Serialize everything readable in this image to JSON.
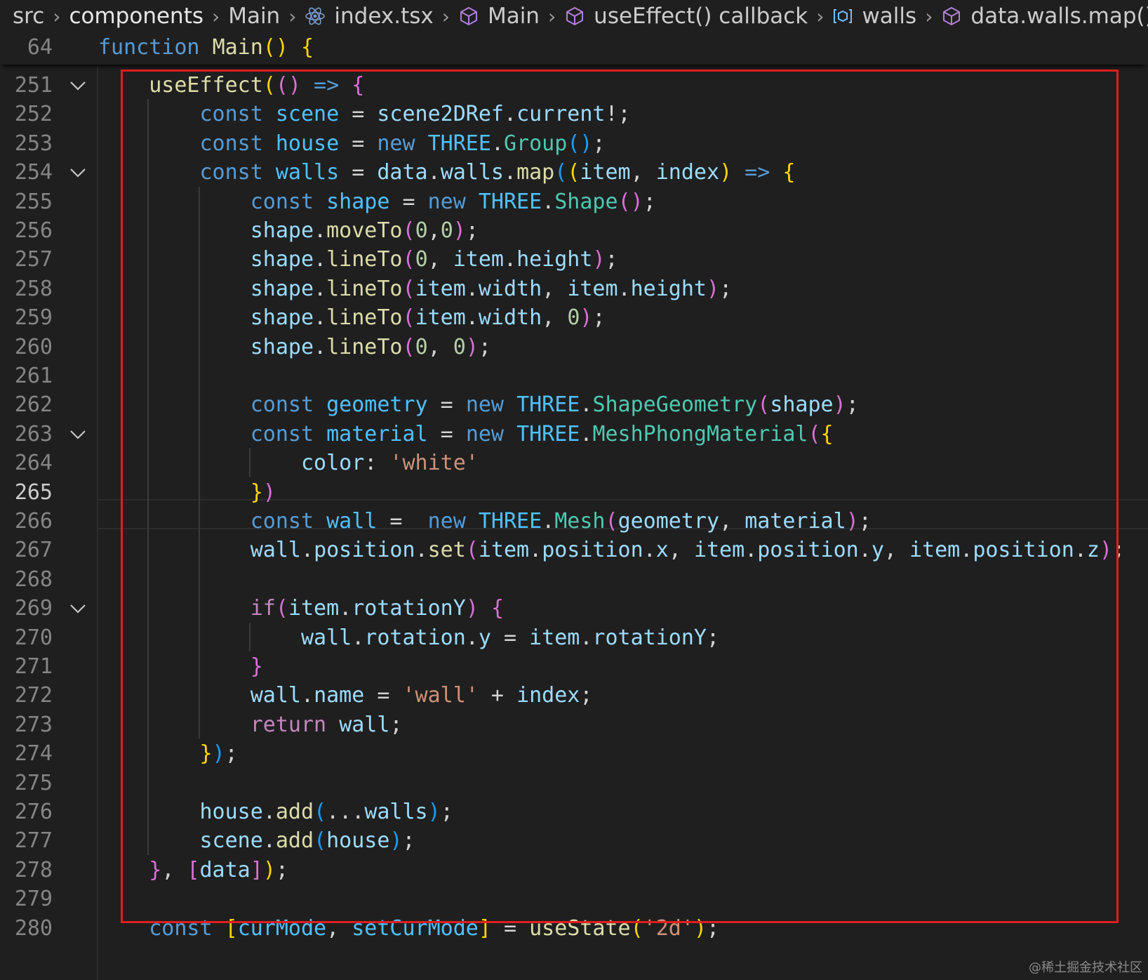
{
  "breadcrumb": [
    {
      "label": "src",
      "icon": ""
    },
    {
      "label": "components",
      "icon": ""
    },
    {
      "label": "Main",
      "icon": ""
    },
    {
      "label": "index.tsx",
      "icon": "react-icon"
    },
    {
      "label": "Main",
      "icon": "cube-icon"
    },
    {
      "label": "useEffect() callback",
      "icon": "cube-icon"
    },
    {
      "label": "walls",
      "icon": "variable-icon"
    },
    {
      "label": "data.walls.map() c",
      "icon": "cube-icon"
    }
  ],
  "sticky": {
    "line": "64",
    "tokens": [
      [
        "function ",
        "kw"
      ],
      [
        "Main",
        "fn"
      ],
      [
        "()",
        "p1"
      ],
      [
        " ",
        "pl"
      ],
      [
        "{",
        "p1"
      ]
    ]
  },
  "current_line": "265",
  "watermark": "@稀土掘金技术社区",
  "colors": {
    "highlight_border": "#e01e1e",
    "background": "#1f1f1f"
  },
  "lines": [
    {
      "n": "251",
      "fold": true,
      "indent": "    ",
      "tokens": [
        [
          "useEffect",
          "fn"
        ],
        [
          "(",
          "p1"
        ],
        [
          "()",
          "p2"
        ],
        [
          " => ",
          "kw"
        ],
        [
          "{",
          "p2"
        ]
      ]
    },
    {
      "n": "252",
      "indent": "        ",
      "tokens": [
        [
          "const ",
          "kw"
        ],
        [
          "scene",
          "cst"
        ],
        [
          " = ",
          "pl"
        ],
        [
          "scene2DRef",
          "var"
        ],
        [
          ".",
          "pl"
        ],
        [
          "current",
          "var"
        ],
        [
          "!;",
          "pl"
        ]
      ]
    },
    {
      "n": "253",
      "indent": "        ",
      "tokens": [
        [
          "const ",
          "kw"
        ],
        [
          "house",
          "cst"
        ],
        [
          " = ",
          "pl"
        ],
        [
          "new ",
          "kw"
        ],
        [
          "THREE",
          "cst"
        ],
        [
          ".",
          "pl"
        ],
        [
          "Group",
          "cls"
        ],
        [
          "()",
          "p3"
        ],
        [
          ";",
          "pl"
        ]
      ]
    },
    {
      "n": "254",
      "fold": true,
      "indent": "        ",
      "tokens": [
        [
          "const ",
          "kw"
        ],
        [
          "walls",
          "cst"
        ],
        [
          " = ",
          "pl"
        ],
        [
          "data",
          "var"
        ],
        [
          ".",
          "pl"
        ],
        [
          "walls",
          "var"
        ],
        [
          ".",
          "pl"
        ],
        [
          "map",
          "fn"
        ],
        [
          "(",
          "p3"
        ],
        [
          "(",
          "p1"
        ],
        [
          "item",
          "var"
        ],
        [
          ", ",
          "pl"
        ],
        [
          "index",
          "var"
        ],
        [
          ")",
          "p1"
        ],
        [
          " => ",
          "kw"
        ],
        [
          "{",
          "p1"
        ]
      ]
    },
    {
      "n": "255",
      "indent": "            ",
      "tokens": [
        [
          "const ",
          "kw"
        ],
        [
          "shape",
          "cst"
        ],
        [
          " = ",
          "pl"
        ],
        [
          "new ",
          "kw"
        ],
        [
          "THREE",
          "cst"
        ],
        [
          ".",
          "pl"
        ],
        [
          "Shape",
          "cls"
        ],
        [
          "()",
          "p2"
        ],
        [
          ";",
          "pl"
        ]
      ]
    },
    {
      "n": "256",
      "indent": "            ",
      "tokens": [
        [
          "shape",
          "var"
        ],
        [
          ".",
          "pl"
        ],
        [
          "moveTo",
          "fn"
        ],
        [
          "(",
          "p2"
        ],
        [
          "0",
          "num"
        ],
        [
          ",",
          "pl"
        ],
        [
          "0",
          "num"
        ],
        [
          ")",
          "p2"
        ],
        [
          ";",
          "pl"
        ]
      ]
    },
    {
      "n": "257",
      "indent": "            ",
      "tokens": [
        [
          "shape",
          "var"
        ],
        [
          ".",
          "pl"
        ],
        [
          "lineTo",
          "fn"
        ],
        [
          "(",
          "p2"
        ],
        [
          "0",
          "num"
        ],
        [
          ", ",
          "pl"
        ],
        [
          "item",
          "var"
        ],
        [
          ".",
          "pl"
        ],
        [
          "height",
          "var"
        ],
        [
          ")",
          "p2"
        ],
        [
          ";",
          "pl"
        ]
      ]
    },
    {
      "n": "258",
      "indent": "            ",
      "tokens": [
        [
          "shape",
          "var"
        ],
        [
          ".",
          "pl"
        ],
        [
          "lineTo",
          "fn"
        ],
        [
          "(",
          "p2"
        ],
        [
          "item",
          "var"
        ],
        [
          ".",
          "pl"
        ],
        [
          "width",
          "var"
        ],
        [
          ", ",
          "pl"
        ],
        [
          "item",
          "var"
        ],
        [
          ".",
          "pl"
        ],
        [
          "height",
          "var"
        ],
        [
          ")",
          "p2"
        ],
        [
          ";",
          "pl"
        ]
      ]
    },
    {
      "n": "259",
      "indent": "            ",
      "tokens": [
        [
          "shape",
          "var"
        ],
        [
          ".",
          "pl"
        ],
        [
          "lineTo",
          "fn"
        ],
        [
          "(",
          "p2"
        ],
        [
          "item",
          "var"
        ],
        [
          ".",
          "pl"
        ],
        [
          "width",
          "var"
        ],
        [
          ", ",
          "pl"
        ],
        [
          "0",
          "num"
        ],
        [
          ")",
          "p2"
        ],
        [
          ";",
          "pl"
        ]
      ]
    },
    {
      "n": "260",
      "indent": "            ",
      "tokens": [
        [
          "shape",
          "var"
        ],
        [
          ".",
          "pl"
        ],
        [
          "lineTo",
          "fn"
        ],
        [
          "(",
          "p2"
        ],
        [
          "0",
          "num"
        ],
        [
          ", ",
          "pl"
        ],
        [
          "0",
          "num"
        ],
        [
          ")",
          "p2"
        ],
        [
          ";",
          "pl"
        ]
      ]
    },
    {
      "n": "261",
      "indent": "",
      "tokens": []
    },
    {
      "n": "262",
      "indent": "            ",
      "tokens": [
        [
          "const ",
          "kw"
        ],
        [
          "geometry",
          "cst"
        ],
        [
          " = ",
          "pl"
        ],
        [
          "new ",
          "kw"
        ],
        [
          "THREE",
          "cst"
        ],
        [
          ".",
          "pl"
        ],
        [
          "ShapeGeometry",
          "cls"
        ],
        [
          "(",
          "p2"
        ],
        [
          "shape",
          "var"
        ],
        [
          ")",
          "p2"
        ],
        [
          ";",
          "pl"
        ]
      ]
    },
    {
      "n": "263",
      "fold": true,
      "indent": "            ",
      "tokens": [
        [
          "const ",
          "kw"
        ],
        [
          "material",
          "cst"
        ],
        [
          " = ",
          "pl"
        ],
        [
          "new ",
          "kw"
        ],
        [
          "THREE",
          "cst"
        ],
        [
          ".",
          "pl"
        ],
        [
          "MeshPhongMaterial",
          "cls"
        ],
        [
          "(",
          "p2"
        ],
        [
          "{",
          "p1"
        ]
      ]
    },
    {
      "n": "264",
      "indent": "                ",
      "tokens": [
        [
          "color",
          "var"
        ],
        [
          ": ",
          "pl"
        ],
        [
          "'white'",
          "str"
        ]
      ]
    },
    {
      "n": "265",
      "indent": "            ",
      "tokens": [
        [
          "}",
          "p1"
        ],
        [
          ")",
          "p2"
        ]
      ]
    },
    {
      "n": "266",
      "indent": "            ",
      "tokens": [
        [
          "const ",
          "kw"
        ],
        [
          "wall",
          "cst"
        ],
        [
          " =  ",
          "pl"
        ],
        [
          "new ",
          "kw"
        ],
        [
          "THREE",
          "cst"
        ],
        [
          ".",
          "pl"
        ],
        [
          "Mesh",
          "cls"
        ],
        [
          "(",
          "p2"
        ],
        [
          "geometry",
          "var"
        ],
        [
          ", ",
          "pl"
        ],
        [
          "material",
          "var"
        ],
        [
          ")",
          "p2"
        ],
        [
          ";",
          "pl"
        ]
      ]
    },
    {
      "n": "267",
      "indent": "            ",
      "tokens": [
        [
          "wall",
          "var"
        ],
        [
          ".",
          "pl"
        ],
        [
          "position",
          "var"
        ],
        [
          ".",
          "pl"
        ],
        [
          "set",
          "fn"
        ],
        [
          "(",
          "p2"
        ],
        [
          "item",
          "var"
        ],
        [
          ".",
          "pl"
        ],
        [
          "position",
          "var"
        ],
        [
          ".",
          "pl"
        ],
        [
          "x",
          "var"
        ],
        [
          ", ",
          "pl"
        ],
        [
          "item",
          "var"
        ],
        [
          ".",
          "pl"
        ],
        [
          "position",
          "var"
        ],
        [
          ".",
          "pl"
        ],
        [
          "y",
          "var"
        ],
        [
          ", ",
          "pl"
        ],
        [
          "item",
          "var"
        ],
        [
          ".",
          "pl"
        ],
        [
          "position",
          "var"
        ],
        [
          ".",
          "pl"
        ],
        [
          "z",
          "var"
        ],
        [
          ")",
          "p2"
        ],
        [
          ";",
          "pl"
        ]
      ]
    },
    {
      "n": "268",
      "indent": "",
      "tokens": []
    },
    {
      "n": "269",
      "fold": true,
      "indent": "            ",
      "tokens": [
        [
          "if",
          "ctl"
        ],
        [
          "(",
          "p2"
        ],
        [
          "item",
          "var"
        ],
        [
          ".",
          "pl"
        ],
        [
          "rotationY",
          "var"
        ],
        [
          ")",
          "p2"
        ],
        [
          " ",
          "pl"
        ],
        [
          "{",
          "p2"
        ]
      ]
    },
    {
      "n": "270",
      "indent": "                ",
      "tokens": [
        [
          "wall",
          "var"
        ],
        [
          ".",
          "pl"
        ],
        [
          "rotation",
          "var"
        ],
        [
          ".",
          "pl"
        ],
        [
          "y",
          "var"
        ],
        [
          " = ",
          "pl"
        ],
        [
          "item",
          "var"
        ],
        [
          ".",
          "pl"
        ],
        [
          "rotationY",
          "var"
        ],
        [
          ";",
          "pl"
        ]
      ]
    },
    {
      "n": "271",
      "indent": "            ",
      "tokens": [
        [
          "}",
          "p2"
        ]
      ]
    },
    {
      "n": "272",
      "indent": "            ",
      "tokens": [
        [
          "wall",
          "var"
        ],
        [
          ".",
          "pl"
        ],
        [
          "name",
          "var"
        ],
        [
          " = ",
          "pl"
        ],
        [
          "'wall'",
          "str"
        ],
        [
          " + ",
          "pl"
        ],
        [
          "index",
          "var"
        ],
        [
          ";",
          "pl"
        ]
      ]
    },
    {
      "n": "273",
      "indent": "            ",
      "tokens": [
        [
          "return ",
          "ctl"
        ],
        [
          "wall",
          "var"
        ],
        [
          ";",
          "pl"
        ]
      ]
    },
    {
      "n": "274",
      "indent": "        ",
      "tokens": [
        [
          "}",
          "p1"
        ],
        [
          ")",
          "p3"
        ],
        [
          ";",
          "pl"
        ]
      ]
    },
    {
      "n": "275",
      "indent": "",
      "tokens": []
    },
    {
      "n": "276",
      "indent": "        ",
      "tokens": [
        [
          "house",
          "var"
        ],
        [
          ".",
          "pl"
        ],
        [
          "add",
          "fn"
        ],
        [
          "(",
          "p3"
        ],
        [
          "...",
          "pl"
        ],
        [
          "walls",
          "var"
        ],
        [
          ")",
          "p3"
        ],
        [
          ";",
          "pl"
        ]
      ]
    },
    {
      "n": "277",
      "indent": "        ",
      "tokens": [
        [
          "scene",
          "var"
        ],
        [
          ".",
          "pl"
        ],
        [
          "add",
          "fn"
        ],
        [
          "(",
          "p3"
        ],
        [
          "house",
          "var"
        ],
        [
          ")",
          "p3"
        ],
        [
          ";",
          "pl"
        ]
      ]
    },
    {
      "n": "278",
      "indent": "    ",
      "tokens": [
        [
          "}",
          "p2"
        ],
        [
          ", ",
          "pl"
        ],
        [
          "[",
          "p2"
        ],
        [
          "data",
          "var"
        ],
        [
          "]",
          "p2"
        ],
        [
          ")",
          "p1"
        ],
        [
          ";",
          "pl"
        ]
      ]
    },
    {
      "n": "279",
      "indent": "",
      "tokens": []
    },
    {
      "n": "280",
      "indent": "    ",
      "tokens": [
        [
          "const ",
          "kw"
        ],
        [
          "[",
          "p1"
        ],
        [
          "curMode",
          "cst"
        ],
        [
          ", ",
          "pl"
        ],
        [
          "setCurMode",
          "cst"
        ],
        [
          "]",
          "p1"
        ],
        [
          " = ",
          "pl"
        ],
        [
          "useState",
          "fn"
        ],
        [
          "(",
          "p1"
        ],
        [
          "'2d'",
          "str"
        ],
        [
          ")",
          "p1"
        ],
        [
          ";",
          "pl"
        ]
      ]
    }
  ]
}
